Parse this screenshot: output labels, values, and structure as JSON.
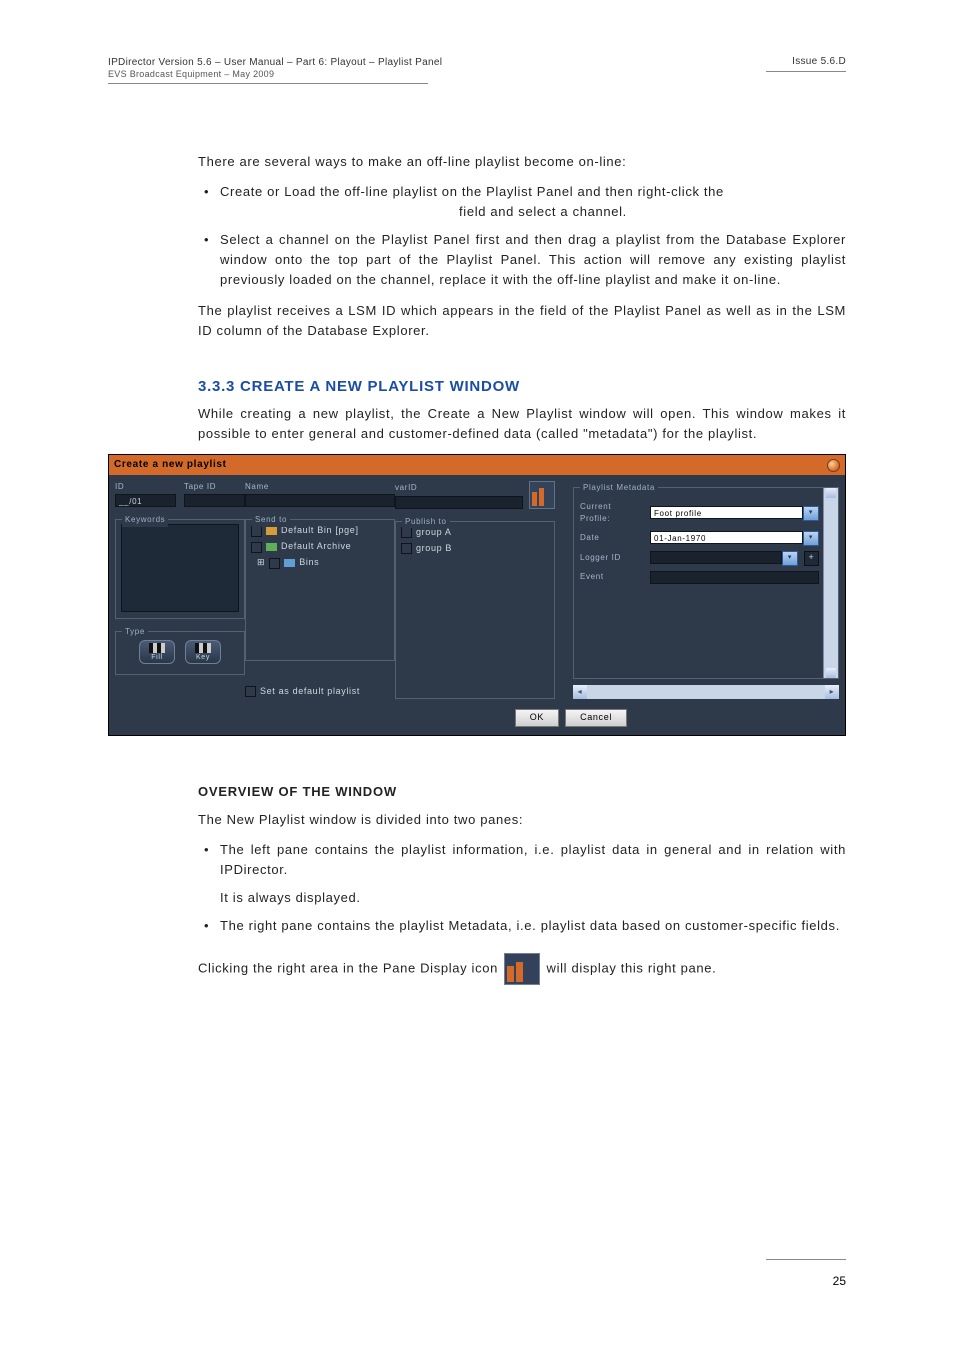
{
  "header": {
    "left_line1": "IPDirector Version 5.6 – User Manual – Part 6: Playout – Playlist Panel",
    "left_line2": "EVS Broadcast Equipment – May 2009",
    "right": "Issue 5.6.D"
  },
  "body": {
    "p1": "There are several ways to make an off-line playlist become on-line:",
    "b1": "Create or Load the off-line playlist on the Playlist Panel and then right-click the",
    "b1b": "field and select a channel.",
    "b2": "Select a channel on the Playlist Panel first and then drag a playlist from the Database Explorer window onto the top part of the Playlist Panel. This action will remove any existing playlist previously loaded on the channel, replace it with the off-line playlist and make it on-line.",
    "p2a": "The playlist receives a LSM ID which appears in the ",
    "p2b": " field of the Playlist Panel as well as in the LSM ID column of the Database Explorer.",
    "sec": "3.3.3 CREATE A NEW PLAYLIST WINDOW",
    "p3": "While creating a new playlist, the Create a New Playlist window will open. This window makes it possible to enter general and customer-defined data (called \"metadata\") for the playlist.",
    "sub": "OVERVIEW OF THE WINDOW",
    "p4": "The New Playlist window is divided into two panes:",
    "b3": "The left pane contains the playlist information, i.e. playlist data in general and in relation with IPDirector.",
    "b3b": "It is always displayed.",
    "b4": "The right pane contains the playlist Metadata, i.e. playlist data based on customer-specific fields.",
    "p5a": "Clicking the right area in the Pane Display icon ",
    "p5b": " will display this right pane."
  },
  "shot": {
    "title": "Create a new playlist",
    "id_label": "ID",
    "id_value": "__/01",
    "tape_label": "Tape ID",
    "name_label": "Name",
    "varid_label": "varID",
    "keywords": "Keywords",
    "sendto": "Send to",
    "publish": "Publish to",
    "type": "Type",
    "send_items": {
      "a": "Default Bin [pge]",
      "b": "Default Archive",
      "c": "Bins"
    },
    "pub_items": {
      "a": "group A",
      "b": "group B"
    },
    "type_fill": "Fill",
    "type_key": "Key",
    "set_default": "Set as default playlist",
    "ok": "OK",
    "cancel": "Cancel",
    "meta": {
      "group": "Playlist Metadata",
      "profile_l": "Current Profile:",
      "profile_v": "Foot profile",
      "date_l": "Date",
      "date_v": "01-Jan-1970",
      "logger_l": "Logger ID",
      "event_l": "Event"
    }
  },
  "page_number": "25"
}
